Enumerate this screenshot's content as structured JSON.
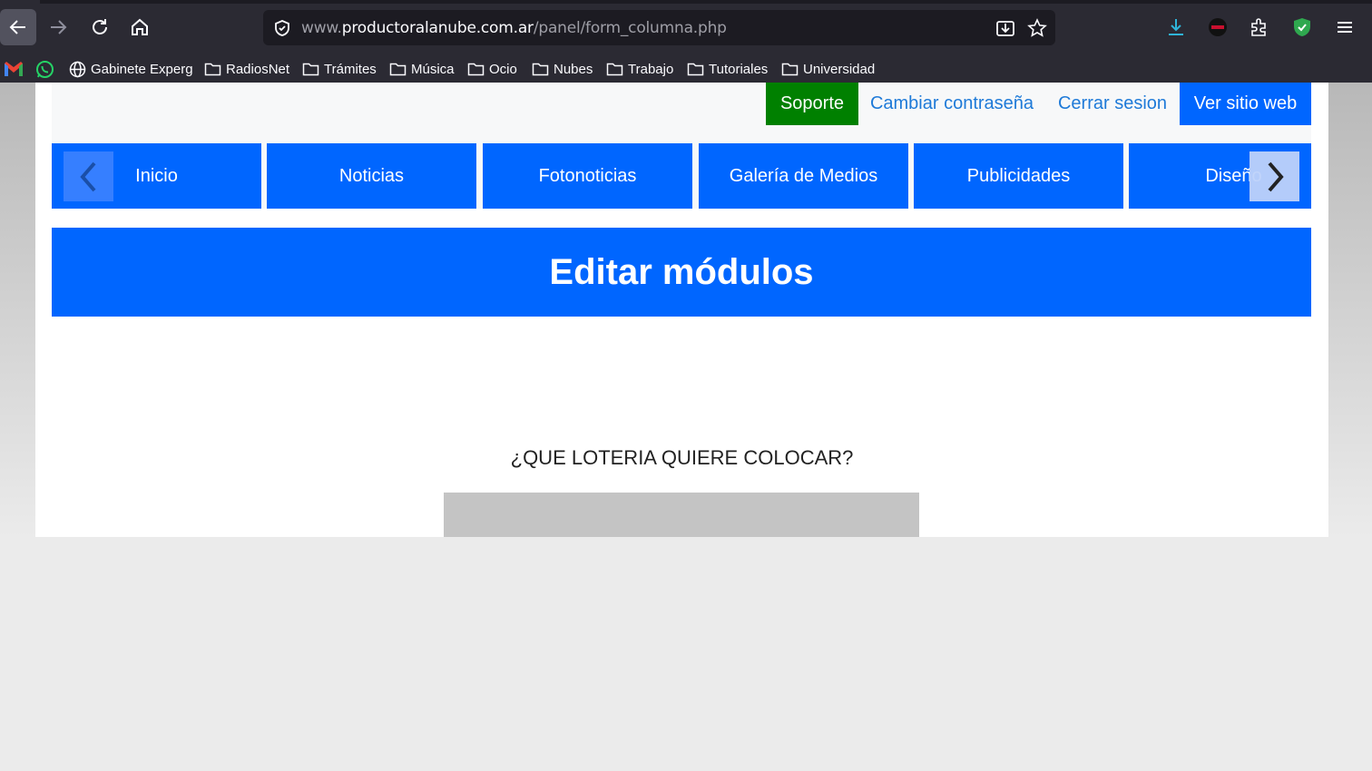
{
  "browser": {
    "url_prefix": "www.",
    "url_host": "productoralanube.com.ar",
    "url_path": "/panel/form_columna.php",
    "accent": "#2b2a33"
  },
  "bookmarks": [
    {
      "label": "",
      "icon": "gmail-icon"
    },
    {
      "label": "",
      "icon": "whatsapp-icon"
    },
    {
      "label": "Gabinete Experg",
      "icon": "globe-icon"
    },
    {
      "label": "RadiosNet",
      "icon": "folder-icon"
    },
    {
      "label": "Trámites",
      "icon": "folder-icon"
    },
    {
      "label": "Música",
      "icon": "folder-icon"
    },
    {
      "label": "Ocio",
      "icon": "folder-icon"
    },
    {
      "label": "Nubes",
      "icon": "folder-icon"
    },
    {
      "label": "Trabajo",
      "icon": "folder-icon"
    },
    {
      "label": "Tutoriales",
      "icon": "folder-icon"
    },
    {
      "label": "Universidad",
      "icon": "folder-icon"
    }
  ],
  "top_links": {
    "support": "Soporte",
    "change_password": "Cambiar contraseña",
    "logout": "Cerrar sesion",
    "website": "Ver sitio web"
  },
  "nav_tabs": [
    "Inicio",
    "Noticias",
    "Fotonoticias",
    "Galería de Medios",
    "Publicidades",
    "Diseño"
  ],
  "banner_title": "Editar módulos",
  "question": "¿QUE LOTERIA QUIERE COLOCAR?",
  "colors": {
    "primary": "#0066ff",
    "support": "#008000",
    "link": "#1e7ad8"
  }
}
